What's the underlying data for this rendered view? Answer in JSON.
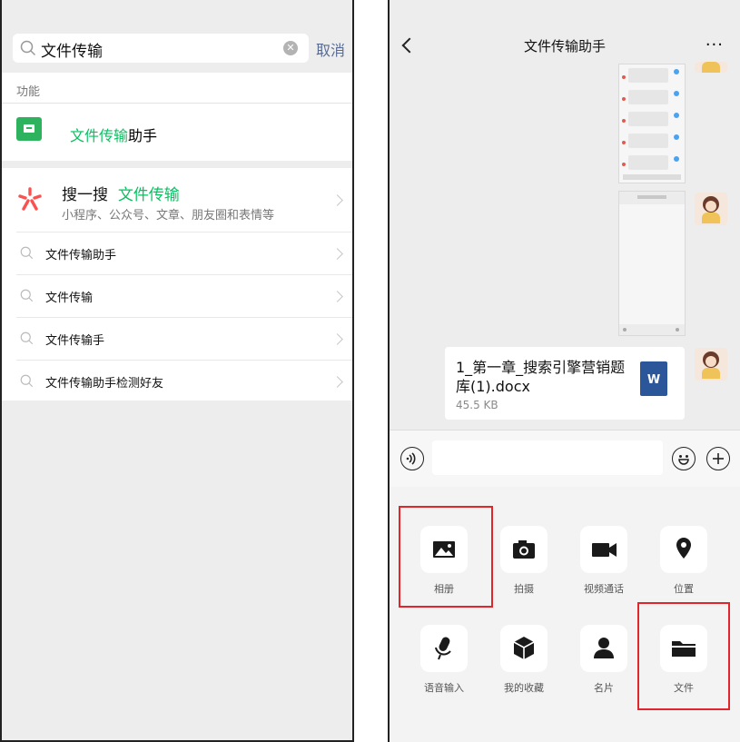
{
  "left": {
    "search": {
      "value": "文件传输",
      "cancel": "取消"
    },
    "function_section": {
      "label": "功能",
      "item": {
        "highlight": "文件传输",
        "rest": "助手"
      }
    },
    "sousou": {
      "prefix": "搜一搜",
      "keyword": "文件传输",
      "subtitle": "小程序、公众号、文章、朋友圈和表情等"
    },
    "suggestions": [
      "文件传输助手",
      "文件传输",
      "文件传输手",
      "文件传输助手检测好友"
    ]
  },
  "right": {
    "nav": {
      "title": "文件传输助手",
      "more": "···"
    },
    "file_message": {
      "name": "1_第一章_搜索引擎营销题库(1).docx",
      "size": "45.5 KB",
      "icon_letter": "W"
    },
    "panel": {
      "items": [
        {
          "label": "相册",
          "icon": "photo-icon"
        },
        {
          "label": "拍摄",
          "icon": "camera-icon"
        },
        {
          "label": "视频通话",
          "icon": "video-call-icon"
        },
        {
          "label": "位置",
          "icon": "location-icon"
        },
        {
          "label": "语音输入",
          "icon": "microphone-icon"
        },
        {
          "label": "我的收藏",
          "icon": "favorites-cube-icon"
        },
        {
          "label": "名片",
          "icon": "contact-card-icon"
        },
        {
          "label": "文件",
          "icon": "folder-icon"
        }
      ]
    },
    "highlight_color": "#e0262a"
  },
  "colors": {
    "wechat_green": "#07c160",
    "link_blue": "#576b95"
  }
}
